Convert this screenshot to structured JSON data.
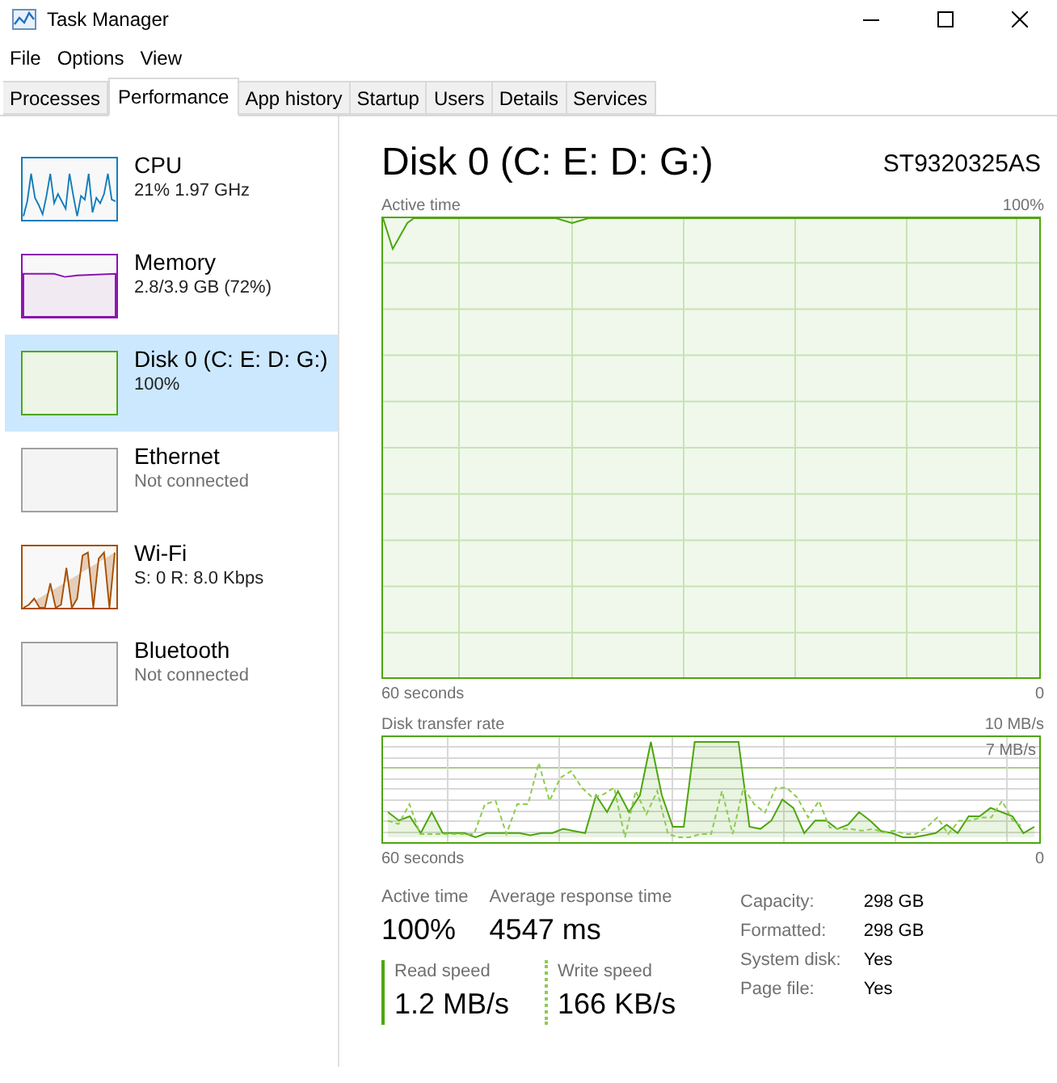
{
  "window": {
    "title": "Task Manager"
  },
  "menu": [
    "File",
    "Options",
    "View"
  ],
  "tabs": [
    {
      "label": "Processes",
      "selected": false
    },
    {
      "label": "Performance",
      "selected": true
    },
    {
      "label": "App history",
      "selected": false
    },
    {
      "label": "Startup",
      "selected": false
    },
    {
      "label": "Users",
      "selected": false
    },
    {
      "label": "Details",
      "selected": false
    },
    {
      "label": "Services",
      "selected": false
    }
  ],
  "sidebar": {
    "items": [
      {
        "kind": "cpu",
        "name": "CPU",
        "detail": "21% 1.97 GHz",
        "color": "#117dbb",
        "selected": false
      },
      {
        "kind": "memory",
        "name": "Memory",
        "detail": "2.8/3.9 GB (72%)",
        "color": "#8b12ae",
        "selected": false
      },
      {
        "kind": "disk",
        "name": "Disk 0 (C: E: D: G:)",
        "detail": "100%",
        "color": "#4da60c",
        "selected": true
      },
      {
        "kind": "empty",
        "name": "Ethernet",
        "detail": "Not connected",
        "color": "#a0a0a0",
        "selected": false
      },
      {
        "kind": "wifi",
        "name": "Wi-Fi",
        "detail": "S: 0 R: 8.0 Kbps",
        "color": "#a74f01",
        "selected": false
      },
      {
        "kind": "empty",
        "name": "Bluetooth",
        "detail": "Not connected",
        "color": "#a0a0a0",
        "selected": false
      }
    ]
  },
  "detail": {
    "title": "Disk 0 (C: E: D: G:)",
    "model": "ST9320325AS",
    "active_chart": {
      "label": "Active time",
      "max": "100%",
      "time": "60 seconds",
      "min": "0"
    },
    "rate_chart": {
      "label": "Disk transfer rate",
      "max": "10 MB/s",
      "marker": "7 MB/s",
      "time": "60 seconds",
      "min": "0"
    },
    "stats": [
      {
        "label": "Active time",
        "value": "100%"
      },
      {
        "label": "Average response time",
        "value": "4547 ms"
      }
    ],
    "speeds": [
      {
        "kind": "read",
        "label": "Read speed",
        "value": "1.2 MB/s"
      },
      {
        "kind": "write",
        "label": "Write speed",
        "value": "166 KB/s"
      }
    ],
    "properties": [
      {
        "label": "Capacity:",
        "value": "298 GB"
      },
      {
        "label": "Formatted:",
        "value": "298 GB"
      },
      {
        "label": "System disk:",
        "value": "Yes"
      },
      {
        "label": "Page file:",
        "value": "Yes"
      }
    ]
  }
}
